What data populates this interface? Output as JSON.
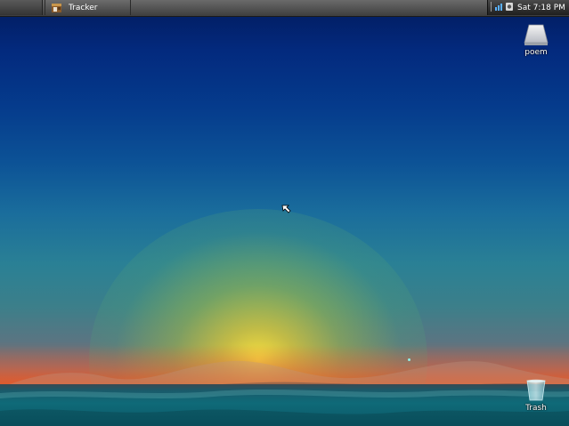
{
  "taskbar": {
    "task_label": "Tracker",
    "clock": "Sat 7:18 PM"
  },
  "desktop": {
    "icons": [
      {
        "label": "poem",
        "icon": "volume-drive-icon"
      },
      {
        "label": "Trash",
        "icon": "trash-icon"
      }
    ]
  },
  "colors": {
    "sky_top": "#021a5c",
    "sky_mid": "#1a6d9c",
    "sun": "#ffe63c",
    "horizon": "#e65a28",
    "sea": "#0f6a78",
    "taskbar": "#4a4a4a"
  }
}
